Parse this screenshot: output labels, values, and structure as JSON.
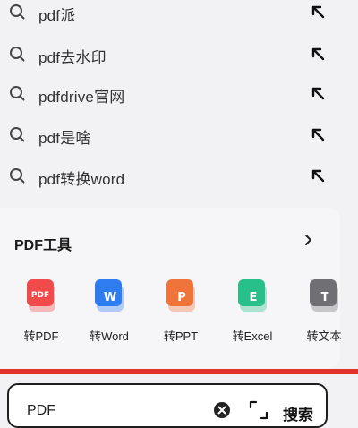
{
  "suggestions": [
    {
      "text": "pdf派",
      "icon": "search-icon",
      "action_icon": "arrow-up-left-icon"
    },
    {
      "text": "pdf去水印",
      "icon": "search-icon",
      "action_icon": "arrow-up-left-icon"
    },
    {
      "text": "pdfdrive官网",
      "icon": "search-icon",
      "action_icon": "arrow-up-left-icon"
    },
    {
      "text": "pdf是啥",
      "icon": "search-icon",
      "action_icon": "arrow-up-left-icon"
    },
    {
      "text": "pdf转换word",
      "icon": "search-icon",
      "action_icon": "arrow-up-left-icon"
    }
  ],
  "tools": {
    "title": "PDF工具",
    "more_icon": "chevron-right-icon",
    "items": [
      {
        "label": "转PDF",
        "badge": "PDF",
        "color": "#f04a4a"
      },
      {
        "label": "转Word",
        "badge": "W",
        "color": "#2f7cf0"
      },
      {
        "label": "转PPT",
        "badge": "P",
        "color": "#f0733a"
      },
      {
        "label": "转Excel",
        "badge": "E",
        "color": "#27c08a"
      },
      {
        "label": "转文本",
        "badge": "T",
        "color": "#6f6f74"
      }
    ]
  },
  "search": {
    "query": "PDF",
    "clear_icon": "clear-icon",
    "scan_icon": "scan-icon",
    "button_label": "搜索"
  },
  "colors": {
    "accent_red": "#e2322a"
  }
}
